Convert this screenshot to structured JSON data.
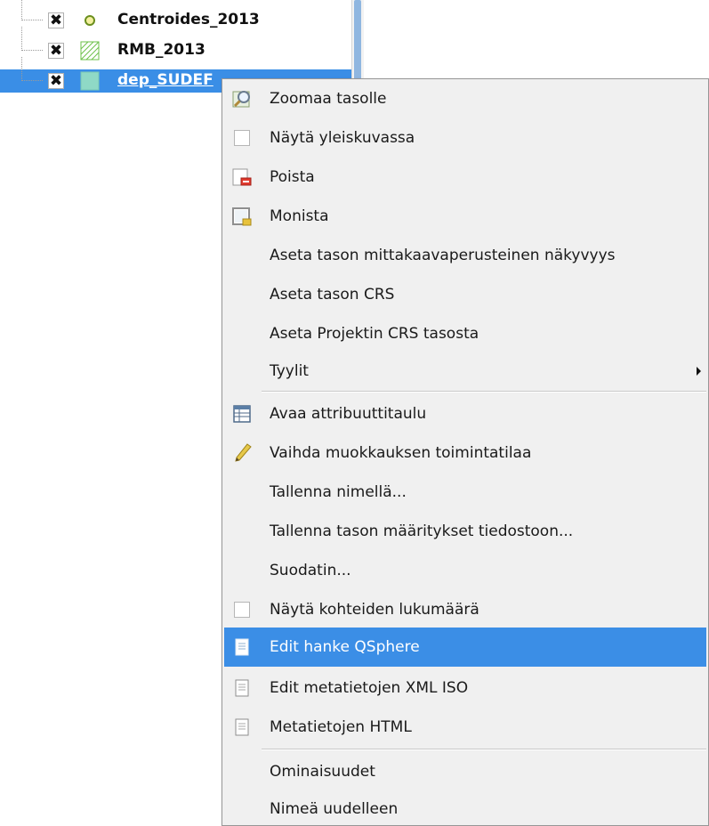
{
  "layer_tree": {
    "layers": [
      {
        "name": "Centroides_2013",
        "visible_mark": "✖",
        "icon": "point-layer-icon",
        "selected": false
      },
      {
        "name": "RMB_2013",
        "visible_mark": "✖",
        "icon": "polygon-hatched-layer-icon",
        "selected": false
      },
      {
        "name": "dep_SUDEF",
        "visible_mark": "✖",
        "icon": "polygon-fill-layer-icon",
        "selected": true
      }
    ]
  },
  "context_menu": {
    "items": [
      {
        "label": "Zoomaa tasolle",
        "icon": "zoom-to-layer-icon"
      },
      {
        "label": "Näytä yleiskuvassa",
        "icon": "checkbox-icon"
      },
      {
        "label": "Poista",
        "icon": "remove-layer-icon"
      },
      {
        "label": "Monista",
        "icon": "duplicate-layer-icon"
      },
      {
        "label": "Aseta tason mittakaavaperusteinen näkyvyys"
      },
      {
        "label": "Aseta tason CRS"
      },
      {
        "label": "Aseta Projektin CRS tasosta"
      },
      {
        "label": "Tyylit",
        "has_submenu": true
      },
      {
        "label": "Avaa attribuuttitaulu",
        "icon": "attribute-table-icon"
      },
      {
        "label": "Vaihda muokkauksen toimintatilaa",
        "icon": "pencil-icon"
      },
      {
        "label": "Tallenna nimellä..."
      },
      {
        "label": "Tallenna tason määritykset tiedostoon..."
      },
      {
        "label": "Suodatin..."
      },
      {
        "label": "Näytä kohteiden lukumäärä",
        "icon": "checkbox-icon"
      },
      {
        "label": "Edit hanke QSphere",
        "icon": "document-icon",
        "highlighted": true
      },
      {
        "label": "Edit metatietojen XML ISO",
        "icon": "document-icon"
      },
      {
        "label": "Metatietojen HTML",
        "icon": "document-icon"
      },
      {
        "label": "Ominaisuudet"
      },
      {
        "label": "Nimeä uudelleen"
      }
    ]
  },
  "colors": {
    "selection": "#3a8ee6",
    "menu_background": "#f0f0f0"
  }
}
